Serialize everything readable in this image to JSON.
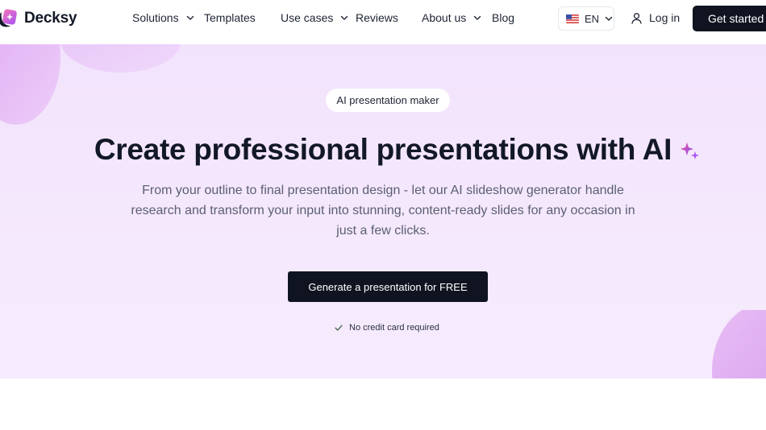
{
  "brand": {
    "name": "Decksy"
  },
  "nav": {
    "items": [
      {
        "label": "Solutions",
        "has_dropdown": true
      },
      {
        "label": "Templates",
        "has_dropdown": false
      },
      {
        "label": "Use cases",
        "has_dropdown": true
      },
      {
        "label": "Reviews",
        "has_dropdown": false
      },
      {
        "label": "About us",
        "has_dropdown": true
      },
      {
        "label": "Blog",
        "has_dropdown": false
      }
    ],
    "language": {
      "code": "EN",
      "flag": "us-flag-icon"
    },
    "login_label": "Log in",
    "cta_label": "Get started"
  },
  "hero": {
    "badge": "AI presentation maker",
    "headline": "Create professional presentations with AI",
    "subtitle": "From your outline to final presentation design - let our AI slideshow generator handle research and transform your input into stunning, content-ready slides for any occasion in just a few clicks.",
    "cta_label": "Generate a presentation for FREE",
    "note": "No credit card required"
  },
  "colors": {
    "primary_dark": "#0f1420",
    "hero_bg": "#f3e6fc",
    "accent_purple": "#a855f7",
    "accent_pink": "#ec4899"
  }
}
